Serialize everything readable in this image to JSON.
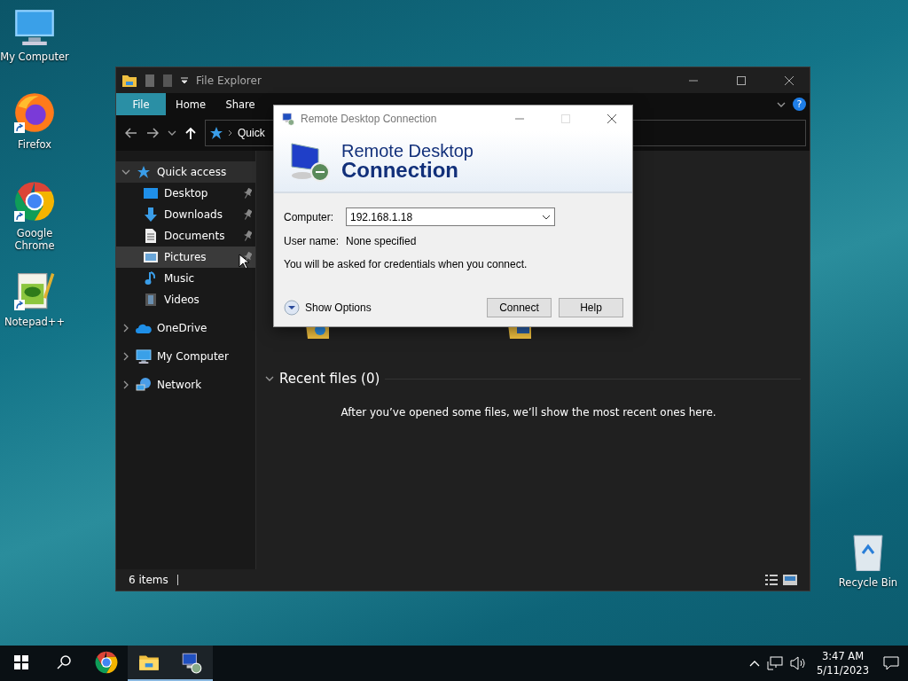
{
  "desktop_icons": [
    {
      "label": "My Computer",
      "kind": "computer",
      "shortcut": false
    },
    {
      "label": "Firefox",
      "kind": "firefox",
      "shortcut": true
    },
    {
      "label": "Google Chrome",
      "kind": "chrome",
      "shortcut": true
    },
    {
      "label": "Notepad++",
      "kind": "notepad",
      "shortcut": true
    }
  ],
  "recycle_bin": {
    "label": "Recycle Bin"
  },
  "explorer": {
    "title": "File Explorer",
    "ribbon_tabs": [
      {
        "label": "File",
        "selected": true
      },
      {
        "label": "Home",
        "selected": false
      },
      {
        "label": "Share",
        "selected": false
      }
    ],
    "help_label": "?",
    "address": {
      "path": "Quick"
    },
    "nav_tree": [
      {
        "label": "Quick access",
        "kind": "star",
        "expanded": true,
        "selected": true,
        "children": [
          {
            "label": "Desktop",
            "kind": "desktop",
            "pinned": true,
            "hovered": false
          },
          {
            "label": "Downloads",
            "kind": "downloads",
            "pinned": true,
            "hovered": false
          },
          {
            "label": "Documents",
            "kind": "documents",
            "pinned": true,
            "hovered": false
          },
          {
            "label": "Pictures",
            "kind": "pictures",
            "pinned": true,
            "hovered": true
          },
          {
            "label": "Music",
            "kind": "music",
            "pinned": false,
            "hovered": false
          },
          {
            "label": "Videos",
            "kind": "videos",
            "pinned": false,
            "hovered": false
          }
        ]
      },
      {
        "label": "OneDrive",
        "kind": "cloud",
        "expanded": false,
        "selected": false
      },
      {
        "label": "My Computer",
        "kind": "computer",
        "expanded": false,
        "selected": false
      },
      {
        "label": "Network",
        "kind": "network",
        "expanded": false,
        "selected": false
      }
    ],
    "recent_files": {
      "heading": "Recent files (0)",
      "expanded": true,
      "message": "After you’ve opened some files, we’ll show the most recent ones here."
    },
    "status_bar": {
      "item_count": "6 items"
    }
  },
  "rdp_dialog": {
    "title": "Remote Desktop Connection",
    "banner_line_1": "Remote Desktop",
    "banner_line_2": "Connection",
    "computer_label": "Computer:",
    "computer_value": "192.168.1.18",
    "username_label": "User name:",
    "username_value": "None specified",
    "note": "You will be asked for credentials when you connect.",
    "show_options": "Show Options",
    "buttons": [
      "Connect",
      "Help"
    ]
  },
  "taskbar": {
    "apps": [
      {
        "kind": "chrome",
        "active": false
      },
      {
        "kind": "explorer",
        "active": true
      },
      {
        "kind": "rdp",
        "active": true
      }
    ],
    "clock": {
      "time": "3:47 AM",
      "date": "5/11/2023"
    }
  }
}
